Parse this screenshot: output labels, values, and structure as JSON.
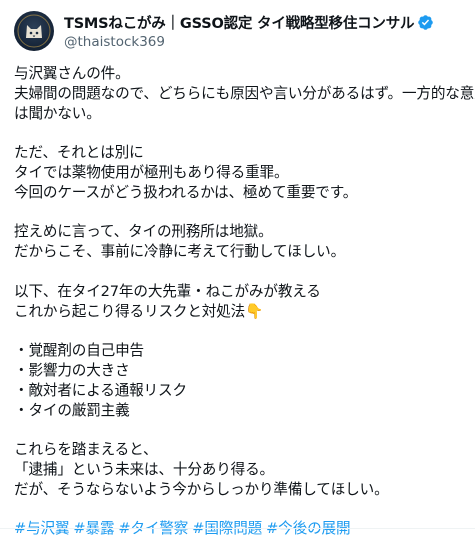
{
  "author": {
    "display_name": "TSMSねこがみ｜GSSO認定 タイ戦略型移住コンサル",
    "handle": "@thaistock369",
    "verified": true,
    "avatar_icon": "cat-avatar-icon",
    "verified_icon": "verified-badge-icon",
    "verified_color": "#1d9bf0"
  },
  "tweet": {
    "paragraphs": [
      {
        "lines": [
          "与沢翼さんの件。",
          "夫婦間の問題なので、どちらにも原因や言い分があるはず。一方的な意見",
          "は聞かない。"
        ]
      },
      {
        "lines": [
          "ただ、それとは別に",
          "タイでは薬物使用が極刑もあり得る重罪。",
          "今回のケースがどう扱われるかは、極めて重要です。"
        ]
      },
      {
        "lines": [
          "控えめに言って、タイの刑務所は地獄。",
          "だからこそ、事前に冷静に考えて行動してほしい。"
        ]
      },
      {
        "lines": [
          "以下、在タイ27年の大先輩・ねこがみが教える",
          "これから起こり得るリスクと対処法👇"
        ]
      },
      {
        "lines": [
          "・覚醒剤の自己申告",
          "・影響力の大きさ",
          "・敵対者による通報リスク",
          "・タイの厳罰主義"
        ]
      },
      {
        "lines": [
          "これらを踏まえると、",
          "「逮捕」という未来は、十分あり得る。",
          "だが、そうならないよう今からしっかり準備してほしい。"
        ]
      }
    ],
    "hashtags": [
      "#与沢翼",
      "#暴露",
      "#タイ警察",
      "#国際問題",
      "#今後の展開"
    ],
    "hashtag_color": "#1d9bf0"
  }
}
